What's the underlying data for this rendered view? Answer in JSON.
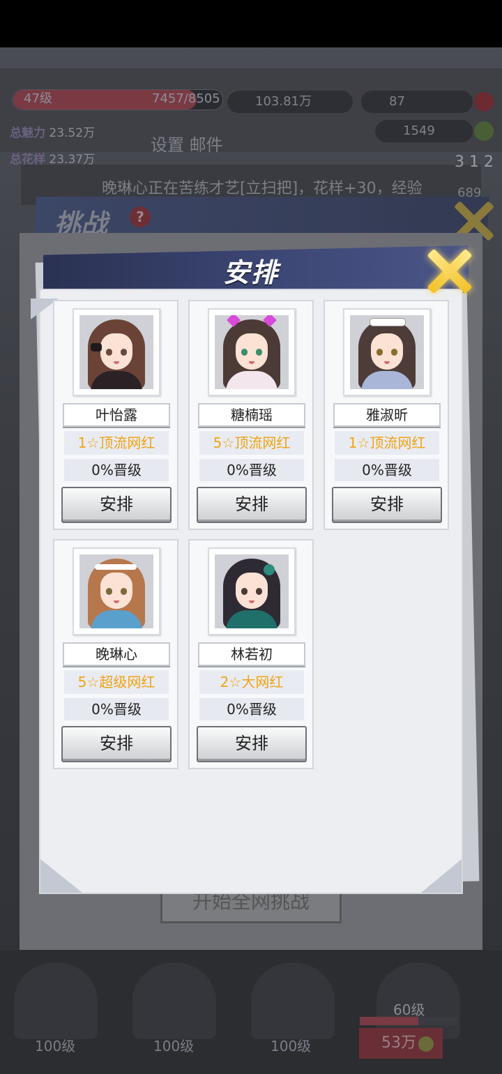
{
  "background": {
    "level": "47级",
    "exp": "7457/8505",
    "exp_fraction": 0.877,
    "gold": "103.81万",
    "roses": "87",
    "diamonds": "1549",
    "charm_label": "总魅力",
    "charm_value": "23.52万",
    "talent_label": "总花样",
    "talent_value": "23.37万",
    "settings_title": "设置 邮件",
    "ticker": "晚琳心正在苦练才艺[立扫把]，花样+30，经验",
    "rank_digits": "3 1 2",
    "rank_value": "689",
    "challenge_title": "挑战",
    "help_glyph": "?",
    "start_button": "开始全网挑战",
    "bottom_levels": [
      "100级",
      "100级",
      "100级"
    ],
    "level_60": "60级",
    "price": "53万",
    "colors": {
      "gold": "#f3c12a",
      "header": "#3d4775"
    }
  },
  "modal": {
    "title": "安排",
    "close_icon": "close-x-icon",
    "cards": [
      {
        "name": "叶怡露",
        "rank": "1☆顶流网红",
        "promo": "0%晋级",
        "button": "安排",
        "hair": "#6b4336",
        "body": "#2b2226",
        "eye": "#6b4a3a",
        "acc": "bow"
      },
      {
        "name": "糖楠瑶",
        "rank": "5☆顶流网红",
        "promo": "0%晋级",
        "button": "安排",
        "hair": "#4c3a36",
        "body": "#f3e6ec",
        "eye": "#3b8f6a",
        "acc": "cat-headphones"
      },
      {
        "name": "雅淑昕",
        "rank": "1☆顶流网红",
        "promo": "0%晋级",
        "button": "安排",
        "hair": "#4e3c38",
        "body": "#aab6d8",
        "eye": "#8a6b2e",
        "acc": "maid-headband"
      },
      {
        "name": "晚琳心",
        "rank": "5☆超级网红",
        "promo": "0%晋级",
        "button": "安排",
        "hair": "#b7774c",
        "body": "#5aa0cc",
        "eye": "#7b6a3a",
        "acc": "white-headband"
      },
      {
        "name": "林若初",
        "rank": "2☆大网红",
        "promo": "0%晋级",
        "button": "安排",
        "hair": "#2e2a33",
        "body": "#1f6f6a",
        "eye": "#4a3a36",
        "acc": "flower"
      }
    ]
  }
}
